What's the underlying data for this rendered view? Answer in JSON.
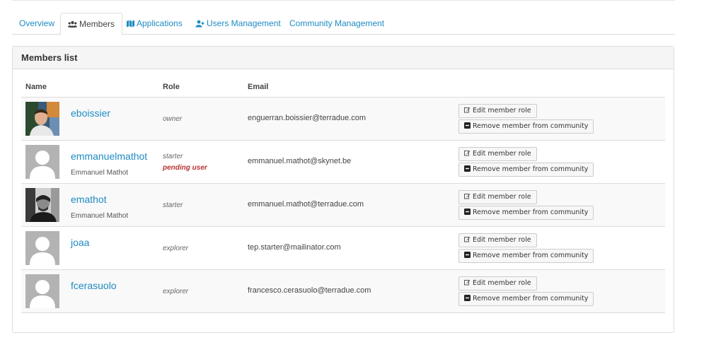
{
  "tabs": [
    {
      "label": "Overview",
      "icon": "",
      "active": false
    },
    {
      "label": "Members",
      "icon": "users-icon",
      "active": true
    },
    {
      "label": "Applications",
      "icon": "map-icon",
      "active": false
    },
    {
      "label": "Users Management",
      "icon": "user-plus-icon",
      "active": false
    },
    {
      "label": "Community Management",
      "icon": "",
      "active": false
    }
  ],
  "panel": {
    "title": "Members list"
  },
  "columns": {
    "name": "Name",
    "role": "Role",
    "email": "Email"
  },
  "buttons": {
    "edit": "Edit member role",
    "remove": "Remove member from community"
  },
  "members": [
    {
      "username": "eboissier",
      "fullname": "",
      "role": "owner",
      "pending": "",
      "email": "enguerran.boissier@terradue.com",
      "avatar": "photo-color"
    },
    {
      "username": "emmanuelmathot",
      "fullname": "Emmanuel Mathot",
      "role": "starter",
      "pending": "pending user",
      "email": "emmanuel.mathot@skynet.be",
      "avatar": "default"
    },
    {
      "username": "emathot",
      "fullname": "Emmanuel Mathot",
      "role": "starter",
      "pending": "",
      "email": "emmanuel.mathot@terradue.com",
      "avatar": "photo-bw"
    },
    {
      "username": "joaa",
      "fullname": "",
      "role": "explorer",
      "pending": "",
      "email": "tep.starter@mailinator.com",
      "avatar": "default"
    },
    {
      "username": "fcerasuolo",
      "fullname": "",
      "role": "explorer",
      "pending": "",
      "email": "francesco.cerasuolo@terradue.com",
      "avatar": "default"
    }
  ],
  "colors": {
    "link": "#1e8bc3",
    "pending": "#bb3333",
    "row_alt": "#f9f9f9"
  }
}
